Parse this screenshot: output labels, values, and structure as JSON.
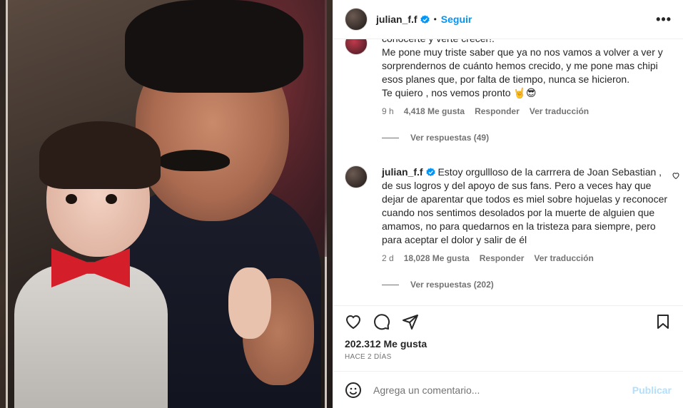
{
  "header": {
    "username": "julian_f.f",
    "separator": "•",
    "follow_label": "Seguir",
    "more_label": "•••"
  },
  "comments": [
    {
      "text": "conocerte y verte crecer!.\nMe pone muy triste saber que ya no nos vamos a volver a ver y sorprendernos de cuánto hemos crecido, y me pone mas chipi esos planes que, por falta de tiempo, nunca se hicieron.\nTe quiero , nos vemos pronto 🤘😎",
      "time": "9 h",
      "likes": "4,418 Me gusta",
      "reply_label": "Responder",
      "translate_label": "Ver traducción",
      "replies_label": "Ver respuestas (49)"
    },
    {
      "username": "julian_f.f",
      "text": "Estoy orgullloso de la carrrera de Joan Sebastian , de sus logros y del apoyo de sus fans. Pero a veces hay que dejar de aparentar que todos es miel sobre hojuelas y reconocer cuando nos sentimos desolados por la muerte de alguien que amamos, no para quedarnos en la tristeza para siempre, pero para aceptar el dolor y salir de él",
      "time": "2 d",
      "likes": "18,028 Me gusta",
      "reply_label": "Responder",
      "translate_label": "Ver traducción",
      "replies_label": "Ver respuestas (202)"
    }
  ],
  "post": {
    "likes": "202.312 Me gusta",
    "ago": "HACE 2 DÍAS"
  },
  "add_comment": {
    "placeholder": "Agrega un comentario...",
    "publish_label": "Publicar"
  },
  "colors": {
    "accent": "#0095f6",
    "publish_disabled": "#b2dffc",
    "muted": "#737373"
  }
}
